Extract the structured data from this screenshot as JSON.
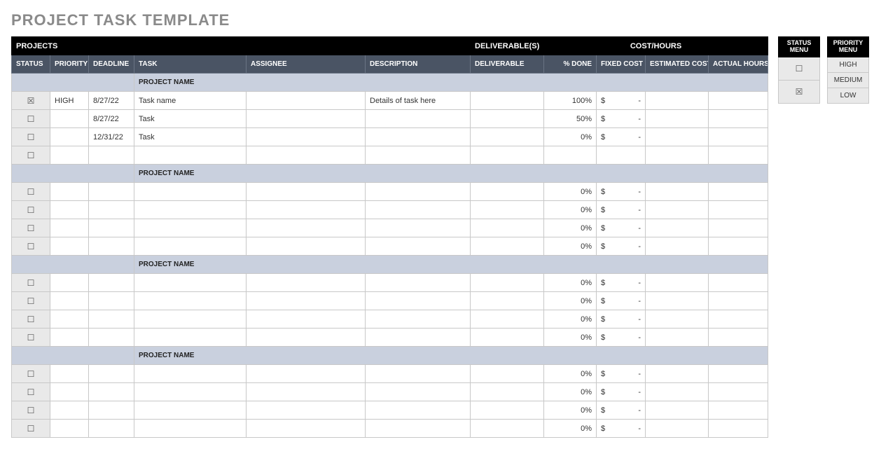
{
  "title": "PROJECT TASK TEMPLATE",
  "hdr1": {
    "projects": "PROJECTS",
    "deliverables": "DELIVERABLE(S)",
    "cost_hours": "COST/HOURS"
  },
  "hdr2": {
    "status": "STATUS",
    "priority": "PRIORITY",
    "deadline": "DEADLINE",
    "task": "TASK",
    "assignee": "ASSIGNEE",
    "description": "DESCRIPTION",
    "deliverable": "DELIVERABLE",
    "pct_done": "% DONE",
    "fixed_cost": "FIXED COST",
    "estimated_cost": "ESTIMATED COST",
    "actual_hours": "ACTUAL HOURS"
  },
  "group_label": "PROJECT NAME",
  "cur": "$",
  "dash": "-",
  "status_icons": {
    "checked": "☒",
    "unchecked": "☐"
  },
  "groups": [
    {
      "rows": [
        {
          "status": "checked",
          "priority": "HIGH",
          "deadline": "8/27/22",
          "task": "Task name",
          "assignee": "",
          "description": "Details of task here",
          "deliverable": "",
          "pct_done": "100%",
          "fixed": true,
          "est": "",
          "act": ""
        },
        {
          "status": "unchecked",
          "priority": "",
          "deadline": "8/27/22",
          "task": "Task",
          "assignee": "",
          "description": "",
          "deliverable": "",
          "pct_done": "50%",
          "fixed": true,
          "est": "",
          "act": ""
        },
        {
          "status": "unchecked",
          "priority": "",
          "deadline": "12/31/22",
          "task": "Task",
          "assignee": "",
          "description": "",
          "deliverable": "",
          "pct_done": "0%",
          "fixed": true,
          "est": "",
          "act": ""
        },
        {
          "status": "unchecked",
          "priority": "",
          "deadline": "",
          "task": "",
          "assignee": "",
          "description": "",
          "deliverable": "",
          "pct_done": "",
          "fixed": false,
          "est": "",
          "act": ""
        }
      ]
    },
    {
      "rows": [
        {
          "status": "unchecked",
          "priority": "",
          "deadline": "",
          "task": "",
          "assignee": "",
          "description": "",
          "deliverable": "",
          "pct_done": "0%",
          "fixed": true,
          "est": "",
          "act": ""
        },
        {
          "status": "unchecked",
          "priority": "",
          "deadline": "",
          "task": "",
          "assignee": "",
          "description": "",
          "deliverable": "",
          "pct_done": "0%",
          "fixed": true,
          "est": "",
          "act": ""
        },
        {
          "status": "unchecked",
          "priority": "",
          "deadline": "",
          "task": "",
          "assignee": "",
          "description": "",
          "deliverable": "",
          "pct_done": "0%",
          "fixed": true,
          "est": "",
          "act": ""
        },
        {
          "status": "unchecked",
          "priority": "",
          "deadline": "",
          "task": "",
          "assignee": "",
          "description": "",
          "deliverable": "",
          "pct_done": "0%",
          "fixed": true,
          "est": "",
          "act": ""
        }
      ]
    },
    {
      "rows": [
        {
          "status": "unchecked",
          "priority": "",
          "deadline": "",
          "task": "",
          "assignee": "",
          "description": "",
          "deliverable": "",
          "pct_done": "0%",
          "fixed": true,
          "est": "",
          "act": ""
        },
        {
          "status": "unchecked",
          "priority": "",
          "deadline": "",
          "task": "",
          "assignee": "",
          "description": "",
          "deliverable": "",
          "pct_done": "0%",
          "fixed": true,
          "est": "",
          "act": ""
        },
        {
          "status": "unchecked",
          "priority": "",
          "deadline": "",
          "task": "",
          "assignee": "",
          "description": "",
          "deliverable": "",
          "pct_done": "0%",
          "fixed": true,
          "est": "",
          "act": ""
        },
        {
          "status": "unchecked",
          "priority": "",
          "deadline": "",
          "task": "",
          "assignee": "",
          "description": "",
          "deliverable": "",
          "pct_done": "0%",
          "fixed": true,
          "est": "",
          "act": ""
        }
      ]
    },
    {
      "rows": [
        {
          "status": "unchecked",
          "priority": "",
          "deadline": "",
          "task": "",
          "assignee": "",
          "description": "",
          "deliverable": "",
          "pct_done": "0%",
          "fixed": true,
          "est": "",
          "act": ""
        },
        {
          "status": "unchecked",
          "priority": "",
          "deadline": "",
          "task": "",
          "assignee": "",
          "description": "",
          "deliverable": "",
          "pct_done": "0%",
          "fixed": true,
          "est": "",
          "act": ""
        },
        {
          "status": "unchecked",
          "priority": "",
          "deadline": "",
          "task": "",
          "assignee": "",
          "description": "",
          "deliverable": "",
          "pct_done": "0%",
          "fixed": true,
          "est": "",
          "act": ""
        },
        {
          "status": "unchecked",
          "priority": "",
          "deadline": "",
          "task": "",
          "assignee": "",
          "description": "",
          "deliverable": "",
          "pct_done": "0%",
          "fixed": true,
          "est": "",
          "act": ""
        }
      ]
    }
  ],
  "status_menu": {
    "title": "STATUS MENU",
    "items": [
      "☐",
      "☒"
    ]
  },
  "priority_menu": {
    "title": "PRIORITY MENU",
    "items": [
      "HIGH",
      "MEDIUM",
      "LOW"
    ]
  }
}
